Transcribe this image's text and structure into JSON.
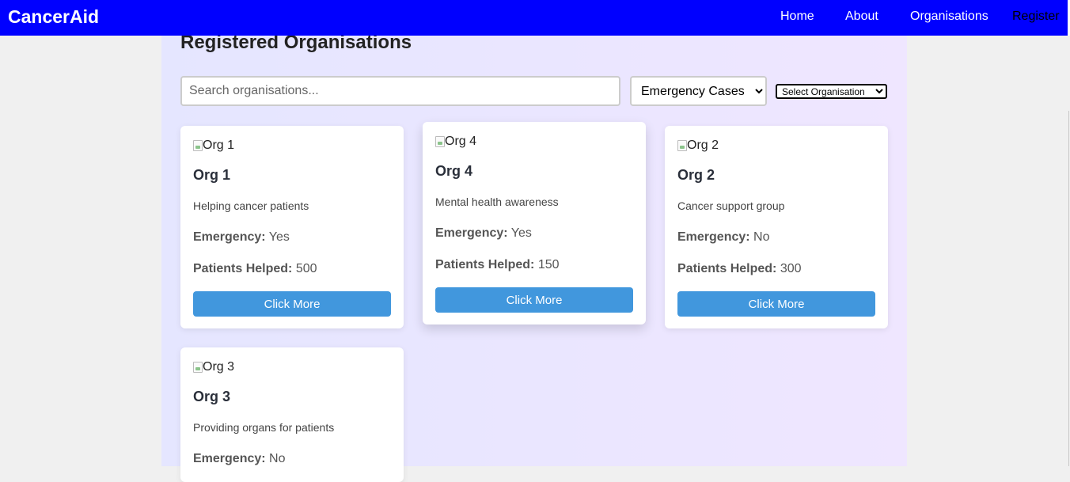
{
  "navbar": {
    "brand": "CancerAid",
    "links": [
      "Home",
      "About",
      "Organisations",
      "Register"
    ]
  },
  "page": {
    "title": "Registered Organisations"
  },
  "filters": {
    "search_placeholder": "Search organisations...",
    "emergency_select": "Emergency Cases",
    "organisation_select": "Select Organisation"
  },
  "cards": [
    {
      "image_alt": "Org 1",
      "name": "Org 1",
      "description": "Helping cancer patients",
      "emergency_label": "Emergency:",
      "emergency": "Yes",
      "patients_label": "Patients Helped:",
      "patients": "500",
      "button": "Click More"
    },
    {
      "image_alt": "Org 4",
      "name": "Org 4",
      "description": "Mental health awareness",
      "emergency_label": "Emergency:",
      "emergency": "Yes",
      "patients_label": "Patients Helped:",
      "patients": "150",
      "button": "Click More"
    },
    {
      "image_alt": "Org 2",
      "name": "Org 2",
      "description": "Cancer support group",
      "emergency_label": "Emergency:",
      "emergency": "No",
      "patients_label": "Patients Helped:",
      "patients": "300",
      "button": "Click More"
    },
    {
      "image_alt": "Org 3",
      "name": "Org 3",
      "description": "Providing organs for patients",
      "emergency_label": "Emergency:",
      "emergency": "No"
    }
  ],
  "colors": {
    "navbar": "#0000ff",
    "button": "#4197dd"
  }
}
